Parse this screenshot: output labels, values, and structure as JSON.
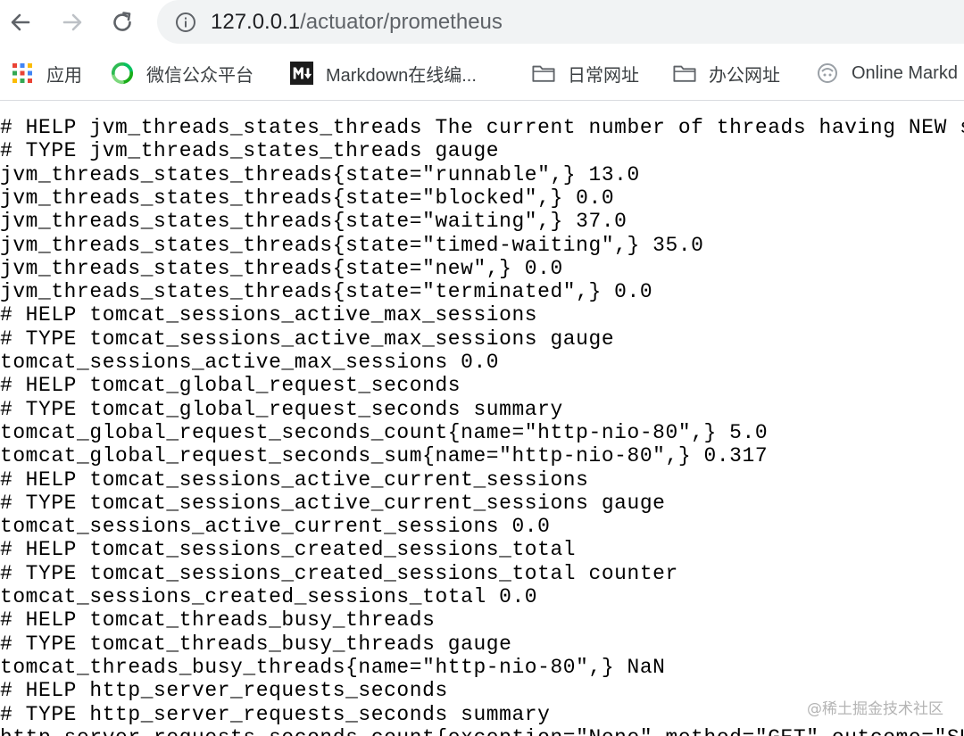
{
  "browser": {
    "url_host": "127.0.0.1",
    "url_path": "/actuator/prometheus"
  },
  "bookmarks": [
    {
      "label": "应用",
      "icon": "apps-grid-icon"
    },
    {
      "label": "微信公众平台",
      "icon": "wechat-icon"
    },
    {
      "label": "Markdown在线编...",
      "icon": "markdown-icon"
    },
    {
      "label": "日常网址",
      "icon": "folder-icon"
    },
    {
      "label": "办公网址",
      "icon": "folder-icon"
    },
    {
      "label": "Online Markd",
      "icon": "online-markdown-icon"
    }
  ],
  "metrics_lines": [
    "# HELP jvm_threads_states_threads The current number of threads having NEW state",
    "# TYPE jvm_threads_states_threads gauge",
    "jvm_threads_states_threads{state=\"runnable\",} 13.0",
    "jvm_threads_states_threads{state=\"blocked\",} 0.0",
    "jvm_threads_states_threads{state=\"waiting\",} 37.0",
    "jvm_threads_states_threads{state=\"timed-waiting\",} 35.0",
    "jvm_threads_states_threads{state=\"new\",} 0.0",
    "jvm_threads_states_threads{state=\"terminated\",} 0.0",
    "# HELP tomcat_sessions_active_max_sessions",
    "# TYPE tomcat_sessions_active_max_sessions gauge",
    "tomcat_sessions_active_max_sessions 0.0",
    "# HELP tomcat_global_request_seconds",
    "# TYPE tomcat_global_request_seconds summary",
    "tomcat_global_request_seconds_count{name=\"http-nio-80\",} 5.0",
    "tomcat_global_request_seconds_sum{name=\"http-nio-80\",} 0.317",
    "# HELP tomcat_sessions_active_current_sessions",
    "# TYPE tomcat_sessions_active_current_sessions gauge",
    "tomcat_sessions_active_current_sessions 0.0",
    "# HELP tomcat_sessions_created_sessions_total",
    "# TYPE tomcat_sessions_created_sessions_total counter",
    "tomcat_sessions_created_sessions_total 0.0",
    "# HELP tomcat_threads_busy_threads",
    "# TYPE tomcat_threads_busy_threads gauge",
    "tomcat_threads_busy_threads{name=\"http-nio-80\",} NaN",
    "# HELP http_server_requests_seconds",
    "# TYPE http_server_requests_seconds summary",
    "http_server_requests_seconds_count{exception=\"None\",method=\"GET\",outcome=\"SUCCESS\""
  ],
  "watermark": "@稀土掘金技术社区"
}
